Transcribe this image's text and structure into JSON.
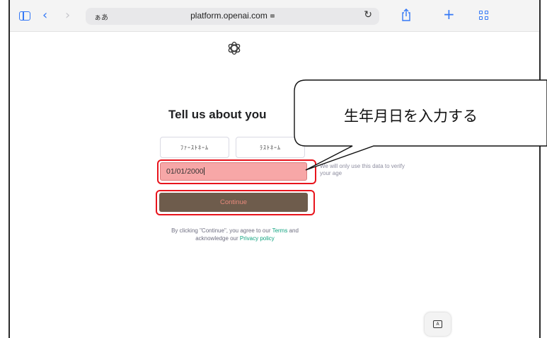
{
  "browser": {
    "address_prefix": "ぁあ",
    "url": "platform.openai.com",
    "icons": {
      "sidebar": "sidebar-icon",
      "back": "back-arrow-icon",
      "forward": "forward-arrow-icon",
      "lock": "lock-icon",
      "reload": "reload-icon",
      "share": "share-icon",
      "new_tab": "plus-icon",
      "tabs": "tab-grid-icon"
    },
    "accent_color": "#3478f6"
  },
  "form": {
    "heading": "Tell us about you",
    "first_name": "ﾌｧｰｽﾄﾈｰﾑ",
    "last_name": "ﾗｽﾄﾈｰﾑ",
    "birthday_value": "01/01/2000",
    "birthday_hint": "We will only use this data to verify your age",
    "continue_label": "Continue",
    "terms_prefix": "By clicking \"Continue\", you agree to our ",
    "terms_link": "Terms",
    "terms_middle": " and acknowledge our ",
    "privacy_link": "Privacy policy",
    "link_color": "#10a37f",
    "highlight_color": "#e8141c"
  },
  "annotation": {
    "callout_text": "生年月日を入力する"
  },
  "keyboard_button_icon": "keyboard-icon"
}
